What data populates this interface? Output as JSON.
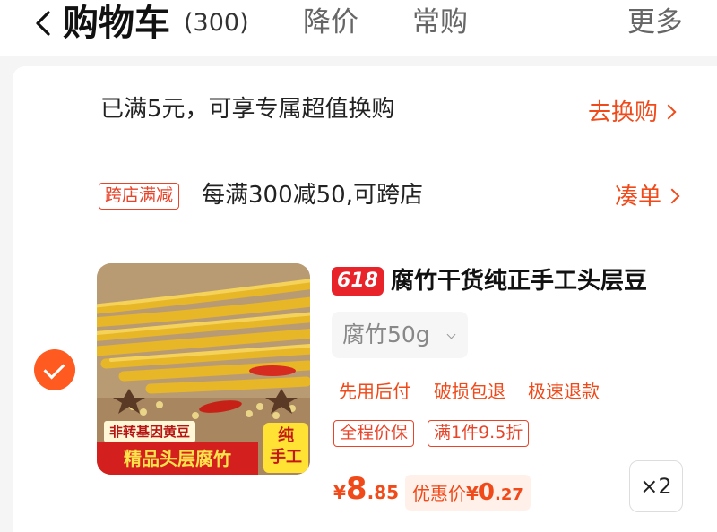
{
  "header": {
    "title": "购物车",
    "count": "(300)",
    "tabs": {
      "price_drop": "降价",
      "frequent": "常购",
      "more": "更多"
    }
  },
  "promo": {
    "exchange_text": "已满5元，可享专属超值换购",
    "exchange_link": "去换购",
    "cross_store_badge": "跨店满减",
    "cross_store_text": "每满300减50,可跨店",
    "cross_store_link": "凑单"
  },
  "item": {
    "badge": "618",
    "title": "腐竹干货纯正手工头层豆",
    "sku": "腐竹50g",
    "services": [
      "先用后付",
      "破损包退",
      "极速退款"
    ],
    "tags": [
      "全程价保",
      "满1件9.5折"
    ],
    "price": {
      "currency": "¥",
      "integer": "8",
      "decimal": ".85"
    },
    "discount": {
      "label": "优惠价",
      "currency": "¥",
      "integer": "0",
      "decimal": ".27"
    },
    "quantity": "×2",
    "image": {
      "tag_top": "非转基因黄豆",
      "tag_bottom": "精品头层腐竹",
      "seal": "纯\n手工"
    }
  },
  "colors": {
    "accent": "#f04a1a",
    "check": "#ff5a1f",
    "badge_red": "#e8232a",
    "discount_bg": "#fff1ea"
  },
  "icons": [
    "back-chevron-icon",
    "chevron-right-icon",
    "checkmark-icon",
    "caret-down-icon"
  ]
}
